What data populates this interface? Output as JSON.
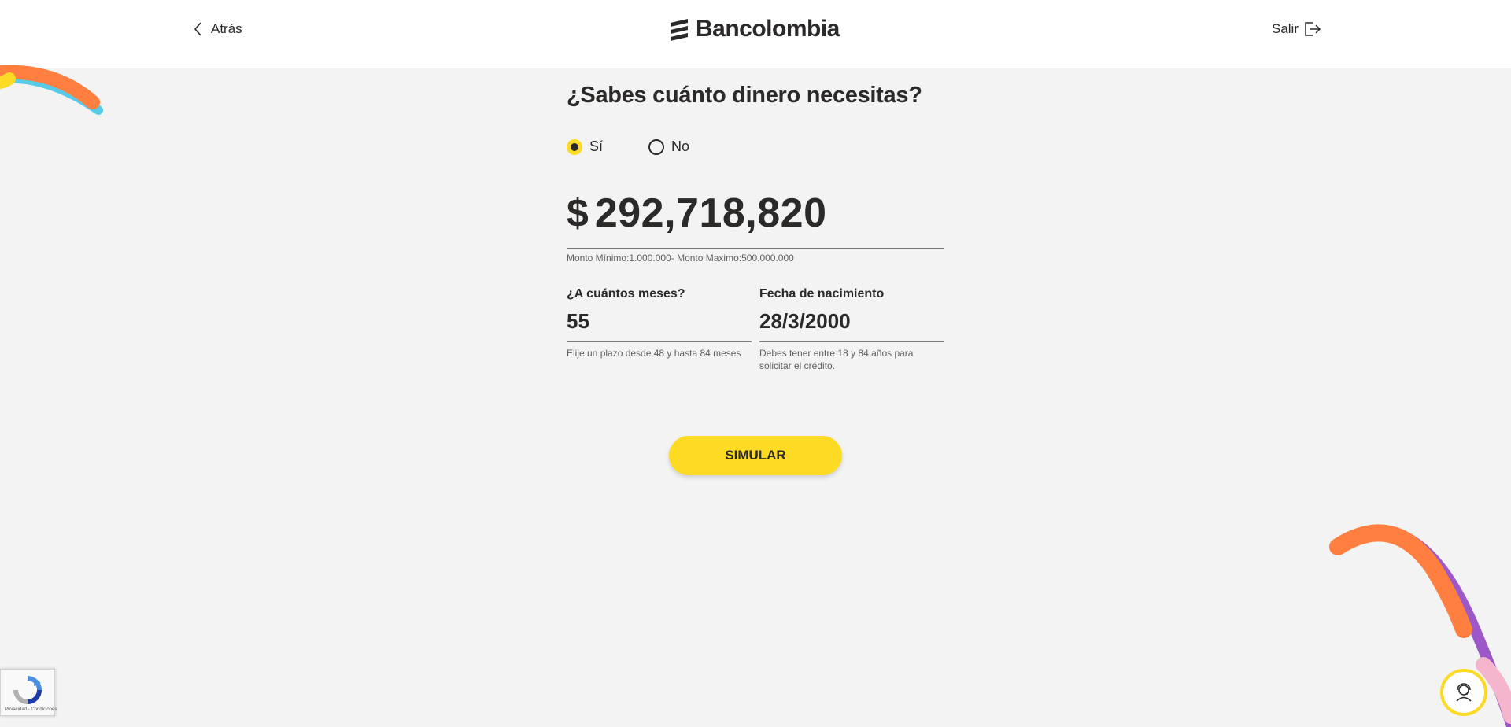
{
  "header": {
    "back_label": "Atrás",
    "brand_name": "Bancolombia",
    "exit_label": "Salir"
  },
  "form": {
    "question": "¿Sabes cuánto dinero necesitas?",
    "options": [
      {
        "label": "Sí",
        "selected": true
      },
      {
        "label": "No",
        "selected": false
      }
    ],
    "currency_symbol": "$",
    "amount": "292,718,820",
    "amount_help": "Monto Mínimo:1.000.000- Monto Maximo:500.000.000",
    "months": {
      "label": "¿A cuántos meses?",
      "value": "55",
      "help": "Elije un plazo desde 48 y hasta 84 meses"
    },
    "birthdate": {
      "label": "Fecha de nacimiento",
      "value": "28/3/2000",
      "help": "Debes tener entre 18 y 84 años para solicitar el crédito."
    },
    "submit_label": "SIMULAR"
  },
  "recaptcha": {
    "footer": "Privacidad - Condiciones"
  },
  "colors": {
    "accent": "#fdda24",
    "text": "#2c2a29",
    "background": "#f3f3f3"
  }
}
